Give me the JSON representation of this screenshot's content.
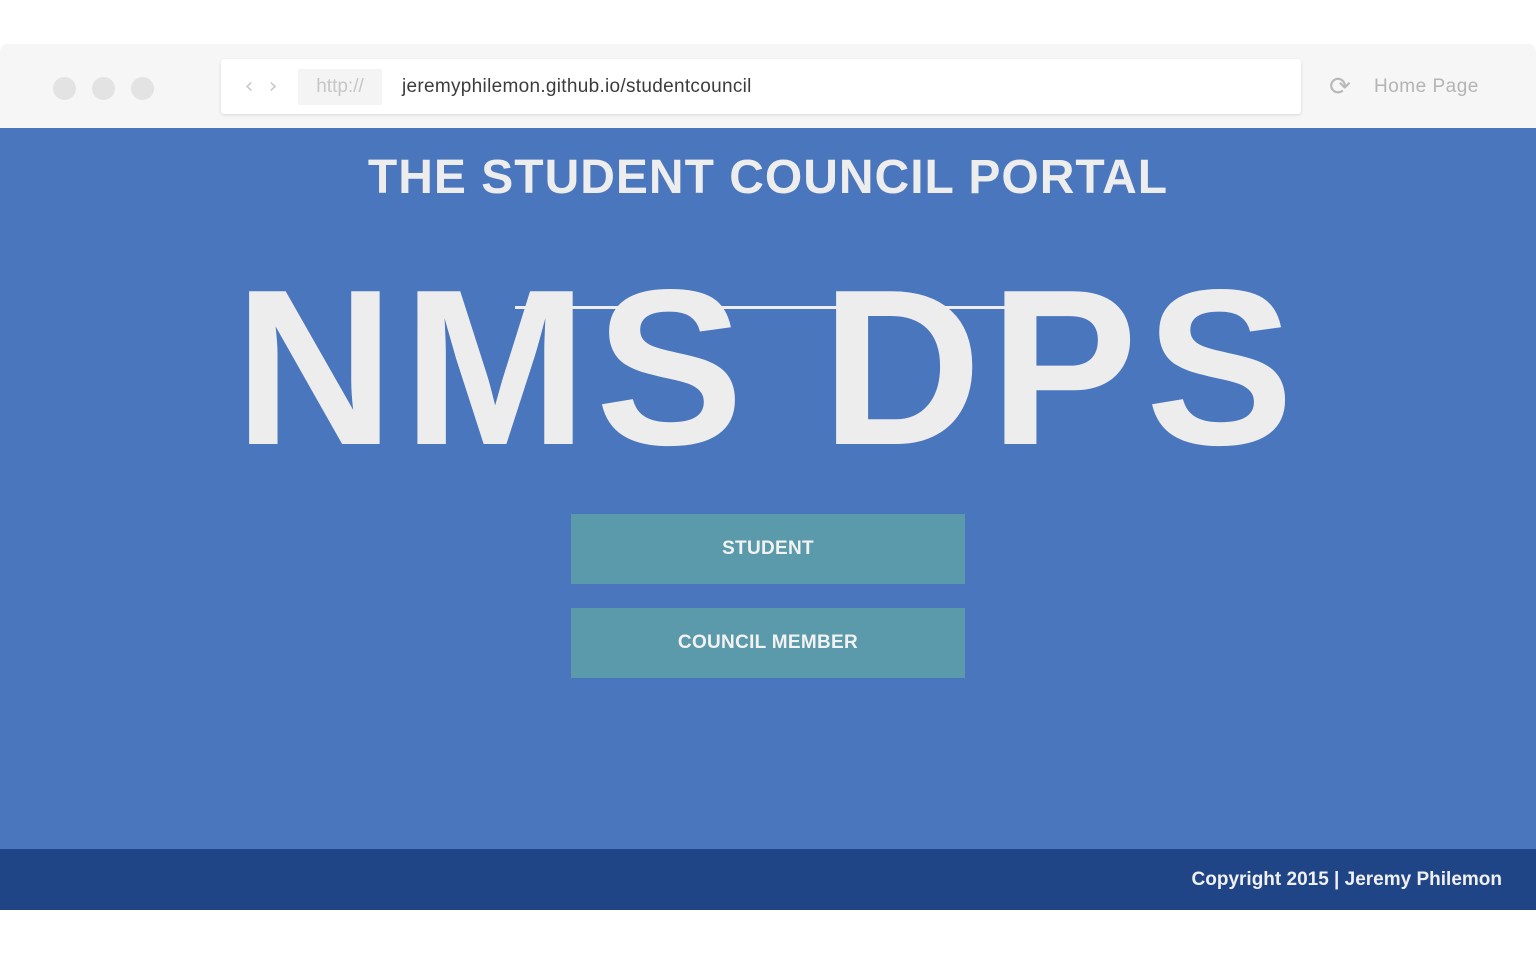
{
  "browser": {
    "protocol": "http://",
    "url": "jeremyphilemon.github.io/studentcouncil",
    "back_icon": "‹",
    "forward_icon": "›",
    "reload_icon": "⟳",
    "home_label": "Home Page"
  },
  "hero": {
    "portal_title": "THE STUDENT COUNCIL PORTAL",
    "school_name": "NMS DPS"
  },
  "buttons": {
    "student": "STUDENT",
    "council_member": "COUNCIL MEMBER"
  },
  "footer": {
    "copyright": "Copyright 2015 | Jeremy Philemon"
  },
  "colors": {
    "page_background": "#4a76bd",
    "button": "#5a9aaa",
    "footer": "#1f4587",
    "text": "#ededed"
  }
}
